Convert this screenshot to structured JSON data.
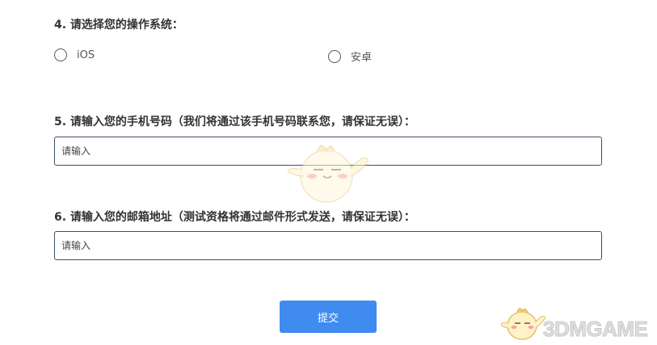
{
  "q4": {
    "title": "4. 请选择您的操作系统：",
    "options": [
      "iOS",
      "安卓"
    ]
  },
  "q5": {
    "title": "5. 请输入您的手机号码（我们将通过该手机号码联系您，请保证无误）：",
    "placeholder": "请输入"
  },
  "q6": {
    "title": "6. 请输入您的邮箱地址（测试资格将通过邮件形式发送，请保证无误）：",
    "placeholder": "请输入"
  },
  "submit_label": "提交",
  "watermark": "3DMGAME",
  "colors": {
    "button": "#3f8bf0",
    "input_border": "#3d4f62",
    "text": "#333333"
  }
}
